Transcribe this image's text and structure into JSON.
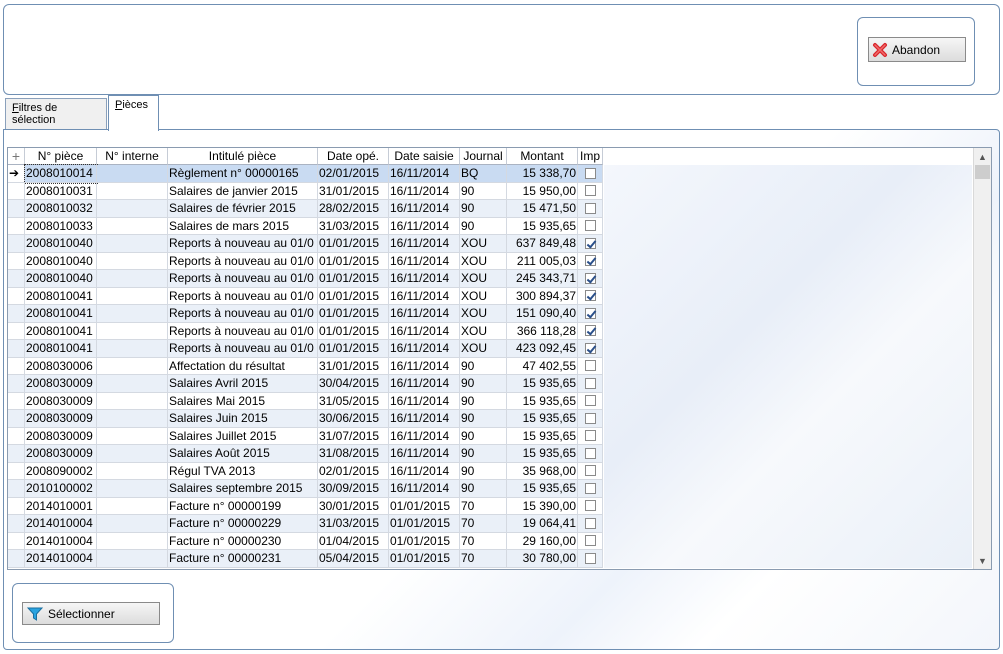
{
  "toolbar": {
    "abandon_label": "Abandon"
  },
  "tabs": [
    {
      "label_first": "F",
      "label_rest": "iltres de sélection"
    },
    {
      "label_first": "P",
      "label_rest": "ièces"
    }
  ],
  "grid": {
    "columns": [
      "",
      "N° pièce",
      "N° interne",
      "Intitulé pièce",
      "Date opé.",
      "Date saisie",
      "Journal",
      "Montant",
      "Imp"
    ],
    "rows": [
      {
        "piece": "2008010014",
        "interne": "",
        "intitule": "Règlement n° 00000165",
        "date_ope": "02/01/2015",
        "date_saisie": "16/11/2014",
        "journal": "BQ",
        "montant": "15 338,70",
        "imp": false
      },
      {
        "piece": "2008010031",
        "interne": "",
        "intitule": "Salaires de janvier 2015",
        "date_ope": "31/01/2015",
        "date_saisie": "16/11/2014",
        "journal": "90",
        "montant": "15 950,00",
        "imp": false
      },
      {
        "piece": "2008010032",
        "interne": "",
        "intitule": "Salaires de février 2015",
        "date_ope": "28/02/2015",
        "date_saisie": "16/11/2014",
        "journal": "90",
        "montant": "15 471,50",
        "imp": false
      },
      {
        "piece": "2008010033",
        "interne": "",
        "intitule": "Salaires de mars 2015",
        "date_ope": "31/03/2015",
        "date_saisie": "16/11/2014",
        "journal": "90",
        "montant": "15 935,65",
        "imp": false
      },
      {
        "piece": "2008010040",
        "interne": "",
        "intitule": "Reports à nouveau au 01/0",
        "date_ope": "01/01/2015",
        "date_saisie": "16/11/2014",
        "journal": "XOU",
        "montant": "637 849,48",
        "imp": true
      },
      {
        "piece": "2008010040",
        "interne": "",
        "intitule": "Reports à nouveau au 01/0",
        "date_ope": "01/01/2015",
        "date_saisie": "16/11/2014",
        "journal": "XOU",
        "montant": "211 005,03",
        "imp": true
      },
      {
        "piece": "2008010040",
        "interne": "",
        "intitule": "Reports à nouveau au 01/0",
        "date_ope": "01/01/2015",
        "date_saisie": "16/11/2014",
        "journal": "XOU",
        "montant": "245 343,71",
        "imp": true
      },
      {
        "piece": "2008010041",
        "interne": "",
        "intitule": "Reports à nouveau au 01/0",
        "date_ope": "01/01/2015",
        "date_saisie": "16/11/2014",
        "journal": "XOU",
        "montant": "300 894,37",
        "imp": true
      },
      {
        "piece": "2008010041",
        "interne": "",
        "intitule": "Reports à nouveau au 01/0",
        "date_ope": "01/01/2015",
        "date_saisie": "16/11/2014",
        "journal": "XOU",
        "montant": "151 090,40",
        "imp": true
      },
      {
        "piece": "2008010041",
        "interne": "",
        "intitule": "Reports à nouveau au 01/0",
        "date_ope": "01/01/2015",
        "date_saisie": "16/11/2014",
        "journal": "XOU",
        "montant": "366 118,28",
        "imp": true
      },
      {
        "piece": "2008010041",
        "interne": "",
        "intitule": "Reports à nouveau au 01/0",
        "date_ope": "01/01/2015",
        "date_saisie": "16/11/2014",
        "journal": "XOU",
        "montant": "423 092,45",
        "imp": true
      },
      {
        "piece": "2008030006",
        "interne": "",
        "intitule": "Affectation du résultat",
        "date_ope": "31/01/2015",
        "date_saisie": "16/11/2014",
        "journal": "90",
        "montant": "47 402,55",
        "imp": false
      },
      {
        "piece": "2008030009",
        "interne": "",
        "intitule": "Salaires Avril 2015",
        "date_ope": "30/04/2015",
        "date_saisie": "16/11/2014",
        "journal": "90",
        "montant": "15 935,65",
        "imp": false
      },
      {
        "piece": "2008030009",
        "interne": "",
        "intitule": "Salaires Mai 2015",
        "date_ope": "31/05/2015",
        "date_saisie": "16/11/2014",
        "journal": "90",
        "montant": "15 935,65",
        "imp": false
      },
      {
        "piece": "2008030009",
        "interne": "",
        "intitule": "Salaires Juin 2015",
        "date_ope": "30/06/2015",
        "date_saisie": "16/11/2014",
        "journal": "90",
        "montant": "15 935,65",
        "imp": false
      },
      {
        "piece": "2008030009",
        "interne": "",
        "intitule": "Salaires Juillet 2015",
        "date_ope": "31/07/2015",
        "date_saisie": "16/11/2014",
        "journal": "90",
        "montant": "15 935,65",
        "imp": false
      },
      {
        "piece": "2008030009",
        "interne": "",
        "intitule": "Salaires Août 2015",
        "date_ope": "31/08/2015",
        "date_saisie": "16/11/2014",
        "journal": "90",
        "montant": "15 935,65",
        "imp": false
      },
      {
        "piece": "2008090002",
        "interne": "",
        "intitule": "Régul TVA 2013",
        "date_ope": "02/01/2015",
        "date_saisie": "16/11/2014",
        "journal": "90",
        "montant": "35 968,00",
        "imp": false
      },
      {
        "piece": "2010100002",
        "interne": "",
        "intitule": "Salaires septembre 2015",
        "date_ope": "30/09/2015",
        "date_saisie": "16/11/2014",
        "journal": "90",
        "montant": "15 935,65",
        "imp": false
      },
      {
        "piece": "2014010001",
        "interne": "",
        "intitule": "Facture n° 00000199",
        "date_ope": "30/01/2015",
        "date_saisie": "01/01/2015",
        "journal": "70",
        "montant": "15 390,00",
        "imp": false
      },
      {
        "piece": "2014010004",
        "interne": "",
        "intitule": "Facture n° 00000229",
        "date_ope": "31/03/2015",
        "date_saisie": "01/01/2015",
        "journal": "70",
        "montant": "19 064,41",
        "imp": false
      },
      {
        "piece": "2014010004",
        "interne": "",
        "intitule": "Facture n° 00000230",
        "date_ope": "01/04/2015",
        "date_saisie": "01/01/2015",
        "journal": "70",
        "montant": "29 160,00",
        "imp": false
      },
      {
        "piece": "2014010004",
        "interne": "",
        "intitule": "Facture n° 00000231",
        "date_ope": "05/04/2015",
        "date_saisie": "01/01/2015",
        "journal": "70",
        "montant": "30 780,00",
        "imp": false
      }
    ]
  },
  "footer": {
    "select_label": "Sélectionner"
  }
}
